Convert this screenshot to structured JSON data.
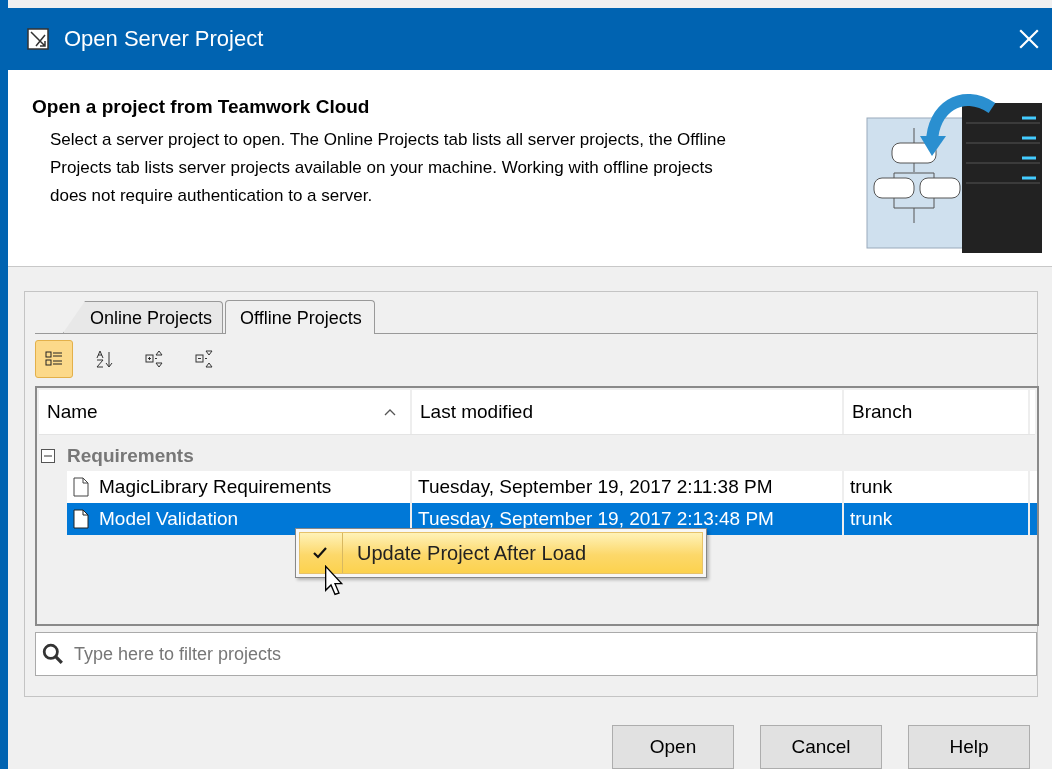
{
  "window": {
    "title": "Open Server Project"
  },
  "header": {
    "title": "Open a project from Teamwork Cloud",
    "description": "Select a server project to open. The Online Projects tab lists all server projects, the Offline Projects tab lists server projects available on your machine. Working with offline projects does not require authentication to a server."
  },
  "tabs": [
    {
      "label": "Online Projects",
      "selected": false
    },
    {
      "label": "Offline Projects",
      "selected": true
    }
  ],
  "toolbar": [
    {
      "kind": "tree",
      "selected": true
    },
    {
      "kind": "sort",
      "selected": false
    },
    {
      "kind": "expand",
      "selected": false
    },
    {
      "kind": "collapse",
      "selected": false
    }
  ],
  "table": {
    "columns": [
      {
        "label": "Name",
        "sorted": true
      },
      {
        "label": "Last modified",
        "sorted": false
      },
      {
        "label": "Branch",
        "sorted": false
      }
    ],
    "groups": [
      {
        "name": "Requirements",
        "expanded": true,
        "children": [
          {
            "name": "MagicLibrary Requirements",
            "modified": "Tuesday, September 19, 2017 2:11:38 PM",
            "branch": "trunk",
            "selected": false
          },
          {
            "name": "Model Validation",
            "modified": "Tuesday, September 19, 2017 2:13:48 PM",
            "branch": "trunk",
            "selected": true
          }
        ]
      }
    ]
  },
  "context_menu": {
    "items": [
      {
        "label": "Update Project After Load",
        "checked": true
      }
    ]
  },
  "filter": {
    "placeholder": "Type here to filter projects"
  },
  "buttons": [
    "Open",
    "Cancel",
    "Help"
  ]
}
